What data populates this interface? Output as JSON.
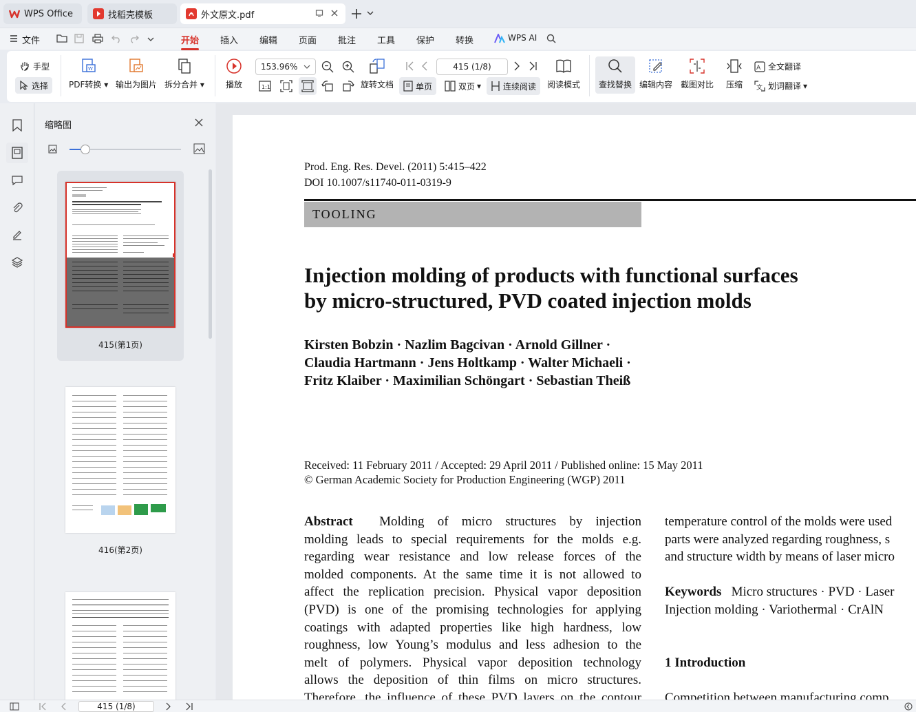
{
  "tabs": [
    {
      "label": "WPS Office"
    },
    {
      "label": "找稻壳模板"
    },
    {
      "label": "外文原文.pdf"
    }
  ],
  "menu": {
    "file": "文件",
    "items": [
      "开始",
      "插入",
      "编辑",
      "页面",
      "批注",
      "工具",
      "保护",
      "转换"
    ],
    "ai": "WPS AI"
  },
  "toolbar": {
    "hand": "手型",
    "select": "选择",
    "pdf_convert": "PDF转换",
    "export_image": "输出为图片",
    "split_merge": "拆分合并",
    "play": "播放",
    "zoom": "153.96%",
    "rotate": "旋转文档",
    "page_input": "415 (1/8)",
    "single": "单页",
    "double": "双页",
    "continuous": "连续阅读",
    "reading": "阅读模式",
    "find": "查找替换",
    "edit_content": "编辑内容",
    "compare": "截图对比",
    "compress": "压缩",
    "full_translate": "全文翻译",
    "word_translate": "划词翻译"
  },
  "sidebar": {
    "title": "缩略图",
    "thumbs": [
      {
        "label": "415(第1页)"
      },
      {
        "label": "416(第2页)"
      }
    ]
  },
  "document": {
    "journal": "Prod. Eng. Res. Devel. (2011) 5:415–422",
    "doi": "DOI 10.1007/s11740-011-0319-9",
    "section": "TOOLING",
    "title_l1": "Injection molding of products with functional surfaces",
    "title_l2": "by micro-structured, PVD coated injection molds",
    "authors_l1": "Kirsten Bobzin · Nazlim Bagcivan · Arnold Gillner ·",
    "authors_l2": "Claudia Hartmann · Jens Holtkamp · Walter Michaeli ·",
    "authors_l3": "Fritz Klaiber · Maximilian Schöngart · Sebastian Theiß",
    "received": "Received: 11 February 2011 / Accepted: 29 April 2011 / Published online: 15 May 2011",
    "copyright": "© German Academic Society for Production Engineering (WGP) 2011",
    "abstract_head": "Abstract",
    "abstract_lines": [
      "Molding of micro structures by injection",
      "molding leads to special requirements for the molds e.g.",
      "regarding wear resistance and low release forces of the",
      "molded components. At the same time it is not allowed to",
      "affect the replication precision. Physical vapor deposition",
      "(PVD) is one of the promising technologies for applying",
      "coatings with adapted properties like high hardness, low",
      "roughness, low Young’s modulus and less adhesion to the",
      "melt of polymers. Physical vapor deposition technology",
      "allows the deposition of thin films on micro structures.",
      "Therefore, the influence of these PVD layers on the contour"
    ],
    "right_lines": [
      "temperature control of the molds were used",
      "parts were analyzed regarding roughness, s",
      "and structure width by means of laser micro"
    ],
    "keywords_head": "Keywords",
    "keywords_l1": "Micro structures · PVD · Laser",
    "keywords_l2": "Injection molding · Variothermal · CrAlN",
    "intro_head": "1  Introduction",
    "intro_l1": "Competition between manufacturing comp"
  },
  "status": {
    "page": "415 (1/8)"
  }
}
